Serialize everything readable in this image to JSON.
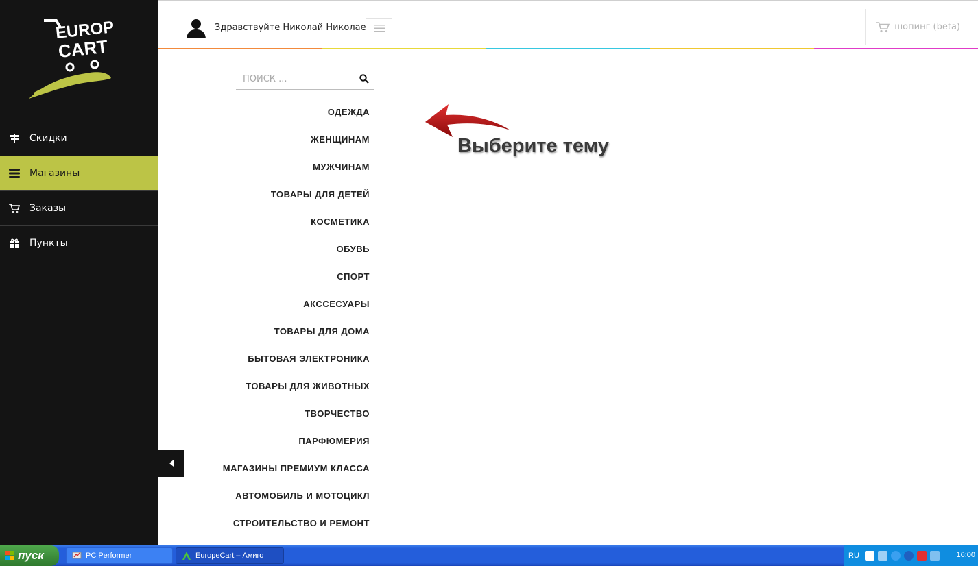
{
  "header": {
    "greeting": "Здравствуйте Николай Николаев!",
    "cart_label": "шопинг (beta)",
    "rainbow_colors": [
      "#f28a3c",
      "#e8d93a",
      "#37c8e0",
      "#f0c832",
      "#e03cc8"
    ]
  },
  "logo": {
    "line1": "EUROPE",
    "line2": "CART",
    "accent": "#bcc446"
  },
  "sidebar": {
    "items": [
      {
        "label": "Скидки",
        "icon": "signpost-icon",
        "active": false
      },
      {
        "label": "Магазины",
        "icon": "list-icon",
        "active": true
      },
      {
        "label": "Заказы",
        "icon": "cart-icon",
        "active": false
      },
      {
        "label": "Пункты",
        "icon": "gift-icon",
        "active": false
      }
    ],
    "active_color": "#bcc446"
  },
  "search": {
    "placeholder": "ПОИСК ..."
  },
  "categories": [
    "ОДЕЖДА",
    "ЖЕНЩИНАМ",
    "МУЖЧИНАМ",
    "ТОВАРЫ ДЛЯ ДЕТЕЙ",
    "КОСМЕТИКА",
    "ОБУВЬ",
    "СПОРТ",
    "АКССЕСУАРЫ",
    "ТОВАРЫ ДЛЯ ДОМА",
    "БЫТОВАЯ ЭЛЕКТРОНИКА",
    "ТОВАРЫ ДЛЯ ЖИВОТНЫХ",
    "ТВОРЧЕСТВО",
    "ПАРФЮМЕРИЯ",
    "МАГАЗИНЫ ПРЕМИУМ КЛАССА",
    "АВТОМОБИЛЬ И МОТОЦИКЛ",
    "СТРОИТЕЛЬСТВО И РЕМОНТ"
  ],
  "hint": {
    "text": "Выберите тему",
    "arrow_color": "#b01010"
  },
  "taskbar": {
    "start_label": "пуск",
    "tasks": [
      {
        "label": "PC Performer"
      },
      {
        "label": "EuropeCart – Амиго"
      }
    ],
    "lang": "RU",
    "time": "16:00"
  }
}
